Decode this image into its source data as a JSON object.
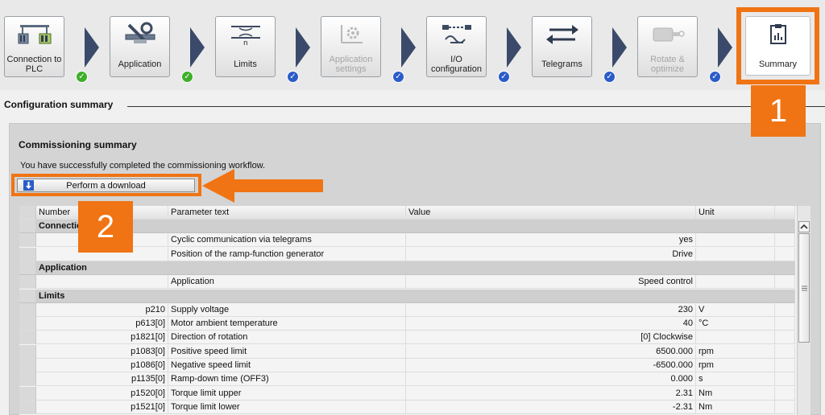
{
  "workflow": {
    "steps": [
      {
        "id": "connection",
        "label": "Connection to PLC",
        "icon": "plc-connection-icon",
        "status": "done",
        "disabled": false
      },
      {
        "id": "application",
        "label": "Application",
        "icon": "tools-icon",
        "status": "done",
        "disabled": false
      },
      {
        "id": "limits",
        "label": "Limits",
        "icon": "limits-icon",
        "status": "checked",
        "disabled": false
      },
      {
        "id": "app-settings",
        "label": "Application settings",
        "icon": "settings-gear-icon",
        "status": "checked",
        "disabled": true
      },
      {
        "id": "io-config",
        "label": "I/O configuration",
        "icon": "io-configuration-icon",
        "status": "checked",
        "disabled": false
      },
      {
        "id": "telegrams",
        "label": "Telegrams",
        "icon": "telegrams-arrows-icon",
        "status": "checked",
        "disabled": false
      },
      {
        "id": "rotate",
        "label": "Rotate & optimize",
        "icon": "motor-icon",
        "status": "checked",
        "disabled": true
      },
      {
        "id": "summary",
        "label": "Summary",
        "icon": "clipboard-icon",
        "status": "active",
        "disabled": false
      }
    ],
    "colors": {
      "done": "#3fae2a",
      "checked": "#2b5cc8",
      "chevron": "#3b4a6b",
      "highlight": "#f07413"
    }
  },
  "section": {
    "title": "Configuration summary"
  },
  "commissioning": {
    "title": "Commissioning summary",
    "message": "You have successfully completed the commissioning workflow.",
    "download_label": "Perform a download"
  },
  "callouts": {
    "one": "1",
    "two": "2"
  },
  "table": {
    "headers": {
      "number": "Number",
      "parameter_text": "Parameter text",
      "value": "Value",
      "unit": "Unit"
    },
    "rows": [
      {
        "group": true,
        "number": "Connection",
        "text": "",
        "value": "",
        "unit": ""
      },
      {
        "group": false,
        "number": "",
        "text": "Cyclic communication via telegrams",
        "value": "yes",
        "unit": ""
      },
      {
        "group": false,
        "number": "",
        "text": "Position of the ramp-function generator",
        "value": "Drive",
        "unit": ""
      },
      {
        "group": true,
        "number": "Application",
        "text": "",
        "value": "",
        "unit": ""
      },
      {
        "group": false,
        "number": "",
        "text": "Application",
        "value": "Speed control",
        "unit": ""
      },
      {
        "group": true,
        "number": "Limits",
        "text": "",
        "value": "",
        "unit": ""
      },
      {
        "group": false,
        "number": "p210",
        "text": "Supply voltage",
        "value": "230",
        "unit": "V"
      },
      {
        "group": false,
        "number": "p613[0]",
        "text": "Motor ambient temperature",
        "value": "40",
        "unit": "°C"
      },
      {
        "group": false,
        "number": "p1821[0]",
        "text": "Direction of rotation",
        "value": "[0] Clockwise",
        "unit": ""
      },
      {
        "group": false,
        "number": "p1083[0]",
        "text": "Positive speed limit",
        "value": "6500.000",
        "unit": "rpm"
      },
      {
        "group": false,
        "number": "p1086[0]",
        "text": "Negative speed limit",
        "value": "-6500.000",
        "unit": "rpm"
      },
      {
        "group": false,
        "number": "p1135[0]",
        "text": "Ramp-down time (OFF3)",
        "value": "0.000",
        "unit": "s"
      },
      {
        "group": false,
        "number": "p1520[0]",
        "text": "Torque limit upper",
        "value": "2.31",
        "unit": "Nm"
      },
      {
        "group": false,
        "number": "p1521[0]",
        "text": "Torque limit lower",
        "value": "-2.31",
        "unit": "Nm"
      }
    ]
  }
}
